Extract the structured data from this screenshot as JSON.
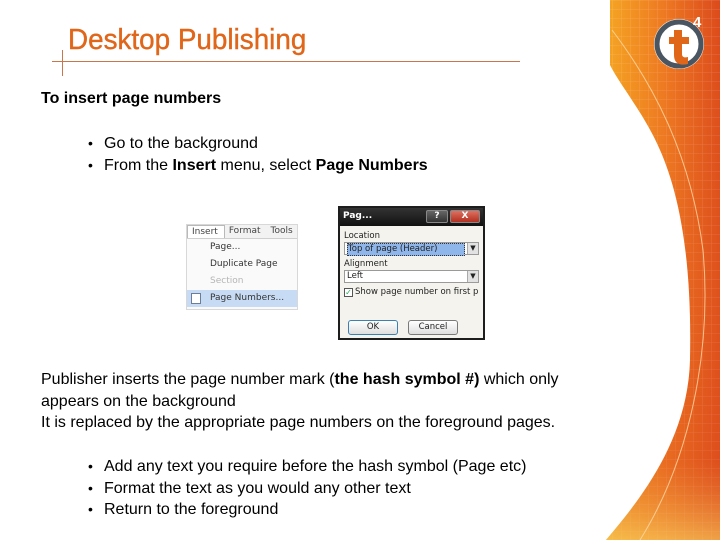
{
  "slide": {
    "title": "Desktop Publishing",
    "logo": {
      "letter": "t",
      "superscript": "4"
    },
    "heading": "To insert page numbers",
    "steps": [
      {
        "text": "Go to the background"
      },
      {
        "pre": "From the ",
        "b1": "Insert",
        "mid": " menu, select ",
        "b2": "Page Numbers"
      }
    ],
    "paragraph": {
      "line1_pre": "Publisher inserts the page number mark (",
      "line1_bold": "the hash symbol #)",
      "line1_post": " which only",
      "line2": "appears on the background",
      "line3": "It is replaced by the appropriate page numbers on the foreground pages."
    },
    "tips": [
      "Add any text you require before the hash symbol  (Page etc)",
      "Format the text as you would any other text",
      "Return to the foreground"
    ],
    "bullet_glyph": "•"
  },
  "insert_menu": {
    "menubar": [
      "Insert",
      "Format",
      "Tools"
    ],
    "items": [
      {
        "label": "Page...",
        "state": "normal"
      },
      {
        "label": "Duplicate Page",
        "state": "normal"
      },
      {
        "label": "Section",
        "state": "disabled"
      },
      {
        "label": "Page Numbers...",
        "state": "highlighted"
      }
    ]
  },
  "page_numbers_dialog": {
    "title": "Pag...",
    "help_label": "?",
    "close_label": "X",
    "location_label": "Location",
    "location_value": "Top of page (Header)",
    "alignment_label": "Alignment",
    "alignment_value": "Left",
    "show_first_page_label": "Show page number on first page",
    "show_first_page_checked": true,
    "ok_label": "OK",
    "cancel_label": "Cancel"
  },
  "colors": {
    "title": "#e0661a",
    "accent_orange": "#f0961e",
    "accent_red": "#e04a1a",
    "logo_ring": "#4a5562"
  }
}
